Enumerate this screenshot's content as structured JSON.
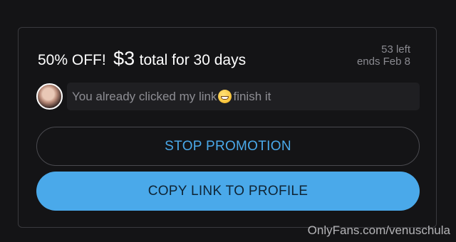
{
  "promotion": {
    "discount": "50% OFF!",
    "price": "$3",
    "duration": "total for 30 days",
    "remaining": "53 left",
    "ends": "ends Feb 8",
    "message_text": "You already clicked my link",
    "message_emoji": "grinning-face-emoji",
    "message_suffix": "finish it"
  },
  "actions": {
    "stop_label": "STOP PROMOTION",
    "copy_label": "COPY LINK TO PROFILE"
  },
  "watermark": "OnlyFans.com/venuschula",
  "colors": {
    "accent": "#4aa9ea",
    "background": "#141416",
    "border": "#3a3a3e",
    "muted_text": "#8a8a90"
  }
}
